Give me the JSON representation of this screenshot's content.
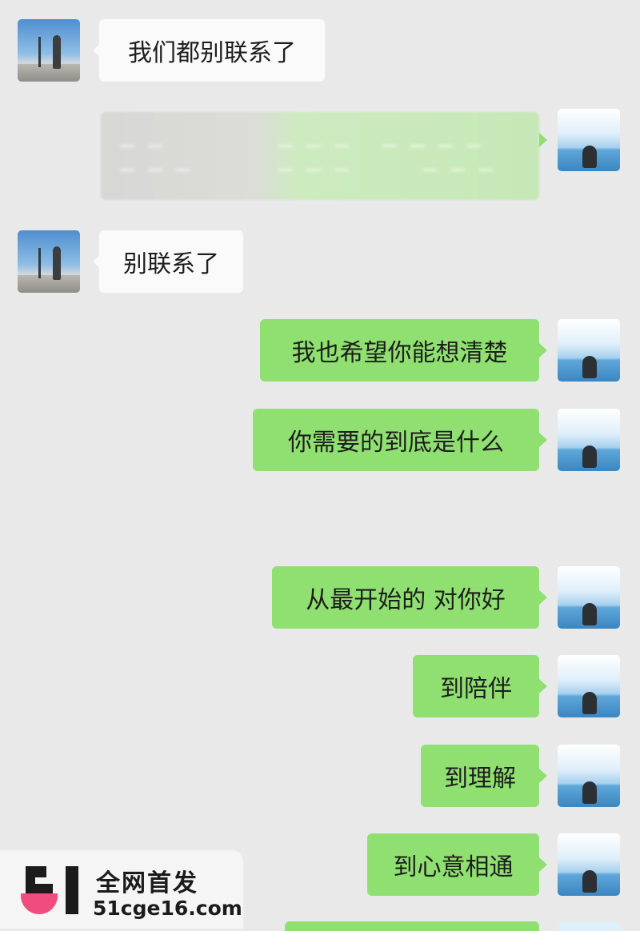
{
  "messages": [
    {
      "side": "left",
      "text": "我们都别联系了"
    },
    {
      "side": "right",
      "text": ""
    },
    {
      "side": "left",
      "text": "别联系了"
    },
    {
      "side": "right",
      "text": "我也希望你能想清楚"
    },
    {
      "side": "right",
      "text": "你需要的到底是什么"
    },
    {
      "side": "right",
      "text": "从最开始的 对你好"
    },
    {
      "side": "right",
      "text": "到陪伴"
    },
    {
      "side": "right",
      "text": "到理解"
    },
    {
      "side": "right",
      "text": "到心意相通"
    }
  ],
  "watermark": {
    "title": "全网首发",
    "url": "51cge16.com",
    "logo_text": "51"
  },
  "colors": {
    "background": "#e9e9ea",
    "outgoing_bubble": "#8fe070",
    "incoming_bubble": "#fafafa",
    "logo_accent": "#ee4d7e"
  }
}
